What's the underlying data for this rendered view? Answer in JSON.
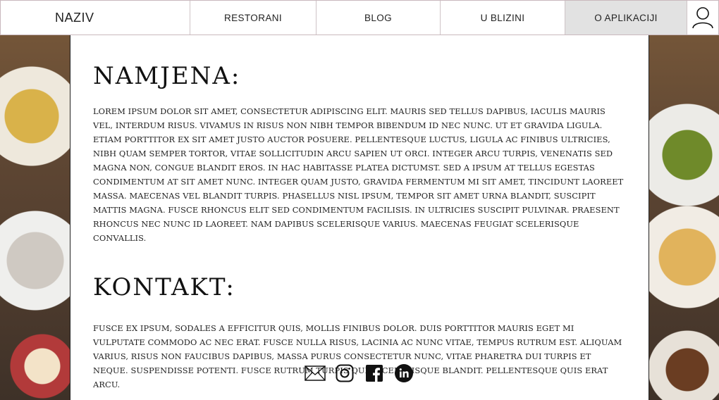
{
  "nav": {
    "brand": "NAZIV",
    "items": [
      {
        "label": "RESTORANI"
      },
      {
        "label": "BLOG"
      },
      {
        "label": "U BLIZINI"
      },
      {
        "label": "O APLIKACIJI",
        "active": true
      }
    ],
    "user_icon": "user-icon"
  },
  "about": {
    "title": "NAMJENA:",
    "text": "Lorem ipsum dolor sit amet, consectetur adipiscing elit. Mauris sed tellus dapibus, iaculis mauris vel, interdum risus. Vivamus in risus non nibh tempor bibendum id nec nunc. Ut et gravida ligula. Etiam porttitor ex sit amet justo auctor posuere. Pellentesque luctus, ligula ac finibus ultricies, nibh quam semper tortor, vitae sollicitudin arcu sapien ut orci. Integer arcu turpis, venenatis sed magna non, congue blandit eros. In hac habitasse platea dictumst. Sed a ipsum at tellus egestas condimentum at sit amet nunc. Integer quam justo, gravida fermentum mi sit amet, tincidunt laoreet massa. Maecenas vel blandit turpis. Phasellus nisl ipsum, tempor sit amet urna blandit, suscipit mattis magna. Fusce rhoncus elit sed condimentum facilisis. In ultricies suscipit pulvinar. Praesent rhoncus nec nunc id laoreet. Nam dapibus scelerisque varius. Maecenas feugiat scelerisque convallis."
  },
  "contact": {
    "title": "KONTAKT:",
    "text": "Fusce ex ipsum, sodales a efficitur quis, mollis finibus dolor. Duis porttitor mauris eget mi vulputate commodo ac nec erat. Fusce nulla risus, lacinia ac nunc vitae, tempus rutrum est. Aliquam varius, risus non faucibus dapibus, massa purus consectetur nunc, vitae pharetra dui turpis et neque. Suspendisse potenti. Fusce rutrum turpis quis scelerisque blandit. Pellentesque quis erat arcu."
  },
  "socials": [
    "mail-icon",
    "instagram-icon",
    "facebook-icon",
    "linkedin-icon"
  ]
}
